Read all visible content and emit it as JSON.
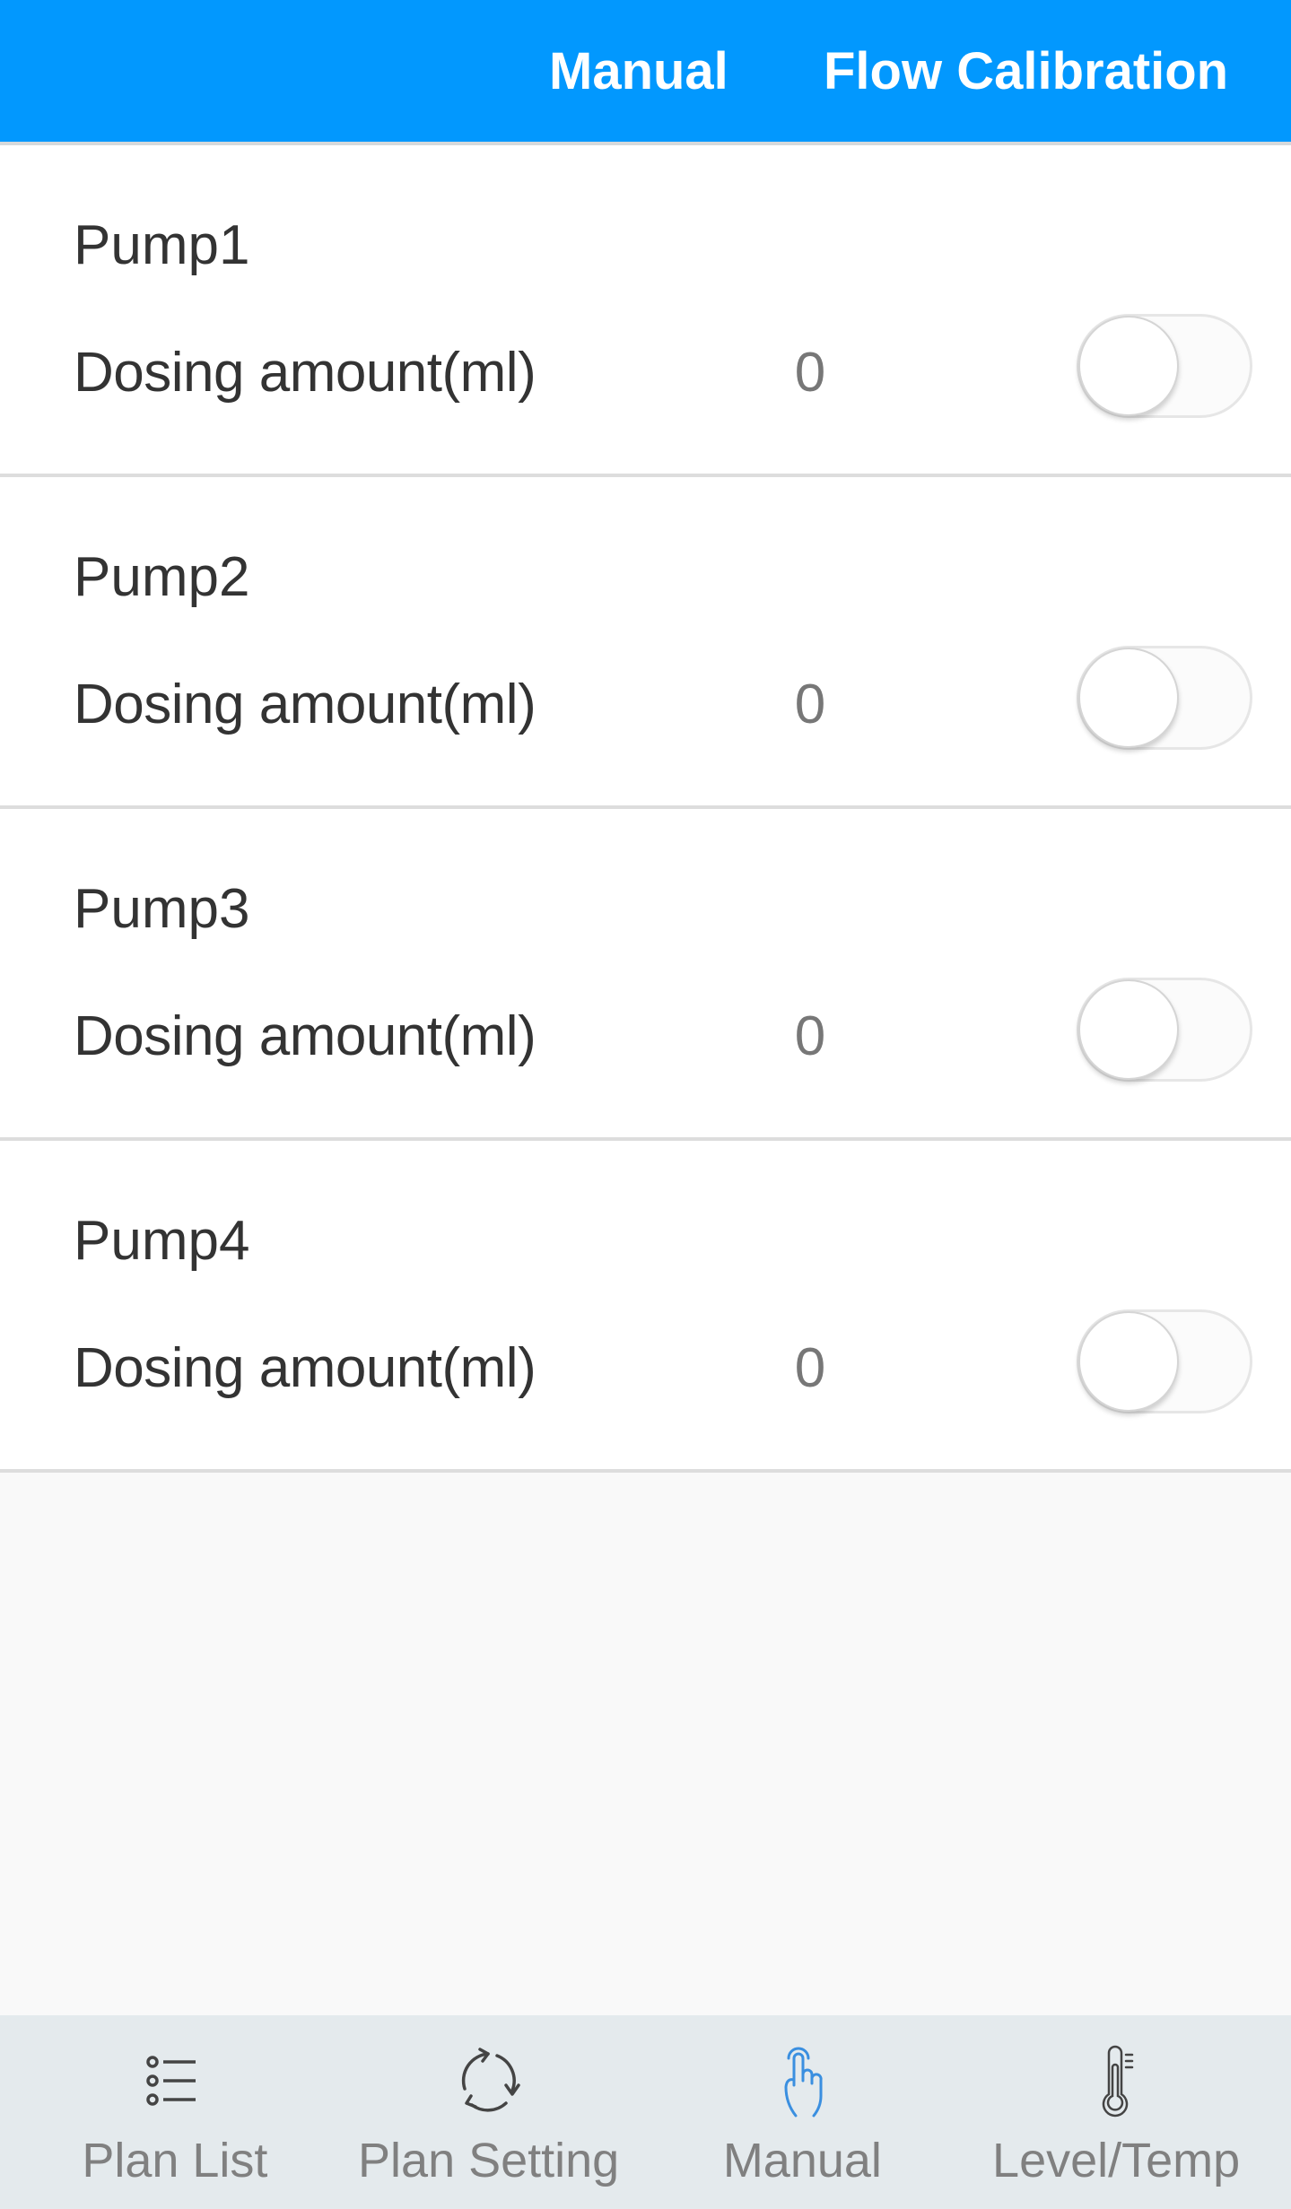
{
  "header": {
    "tabs": [
      {
        "label": "Manual",
        "active": true
      },
      {
        "label": "Flow Calibration",
        "active": false
      }
    ],
    "background_color": "#0298FE"
  },
  "pumps": [
    {
      "name": "Pump1",
      "dosing_label": "Dosing amount(ml)",
      "dosing_value": "0",
      "enabled": false
    },
    {
      "name": "Pump2",
      "dosing_label": "Dosing amount(ml)",
      "dosing_value": "0",
      "enabled": false
    },
    {
      "name": "Pump3",
      "dosing_label": "Dosing amount(ml)",
      "dosing_value": "0",
      "enabled": false
    },
    {
      "name": "Pump4",
      "dosing_label": "Dosing amount(ml)",
      "dosing_value": "0",
      "enabled": false
    }
  ],
  "bottom_nav": {
    "items": [
      {
        "label": "Plan List",
        "icon": "list-icon",
        "active": false
      },
      {
        "label": "Plan Setting",
        "icon": "cycle-icon",
        "active": false
      },
      {
        "label": "Manual",
        "icon": "hand-tap-icon",
        "active": true
      },
      {
        "label": "Level/Temp",
        "icon": "thermometer-icon",
        "active": false
      }
    ],
    "active_icon_color": "#3A8FE0",
    "inactive_icon_color": "#444444"
  }
}
